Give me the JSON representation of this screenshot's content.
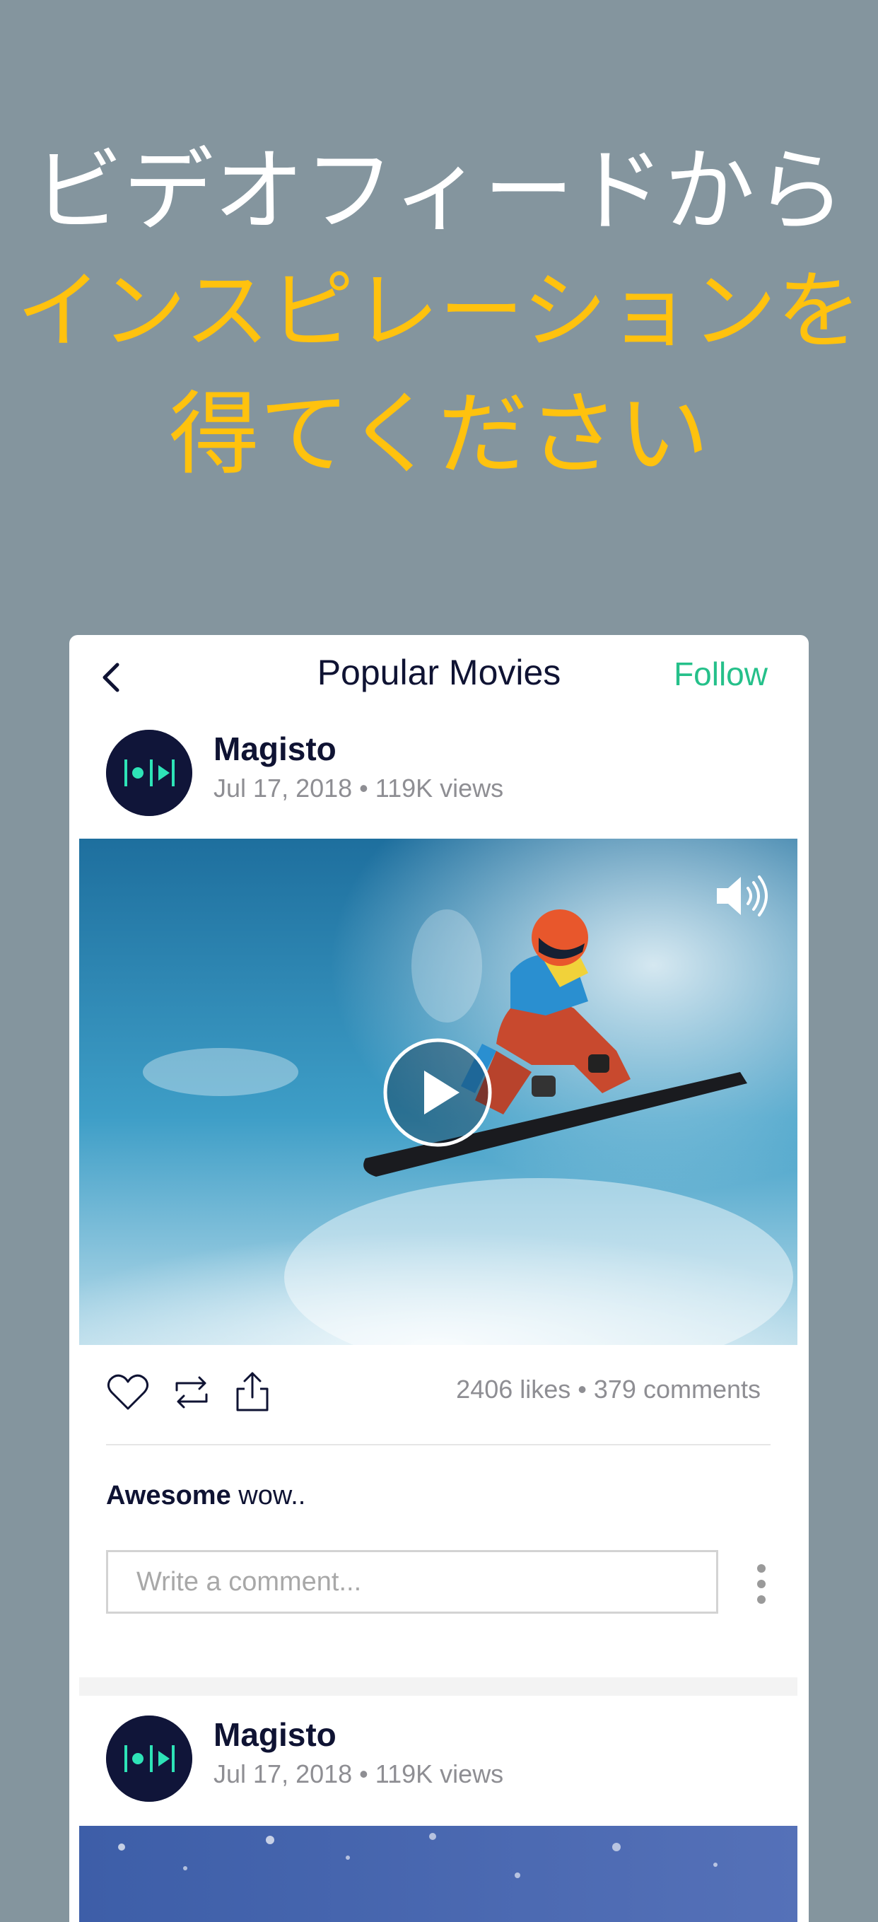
{
  "headline": {
    "line1": "ビデオフィードから",
    "line2": "インスピレーションを",
    "line3": "得てください"
  },
  "colors": {
    "background": "#84959e",
    "headline_white": "#ffffff",
    "headline_yellow": "#ffc20e",
    "accent_green": "#25c08a",
    "avatar_navy": "#101539"
  },
  "navbar": {
    "back_icon": "chevron-left-icon",
    "title": "Popular Movies",
    "follow_label": "Follow"
  },
  "posts": [
    {
      "author": "Magisto",
      "meta": "Jul 17, 2018 • 119K views",
      "stats": "2406 likes • 379 comments",
      "caption_bold": "Awesome",
      "caption_rest": " wow..",
      "comment_placeholder": "Write a comment..."
    },
    {
      "author": "Magisto",
      "meta": "Jul 17, 2018 • 119K views"
    }
  ],
  "icons": {
    "sound": "speaker-icon",
    "play": "play-icon",
    "like": "heart-icon",
    "repost": "repost-icon",
    "share": "share-icon",
    "more": "more-vertical-icon"
  }
}
